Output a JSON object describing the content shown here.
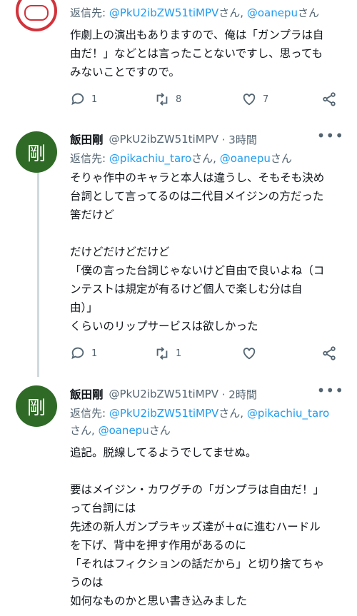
{
  "tweets": [
    {
      "reply_prefix": "返信先: ",
      "mentions": [
        "@PkU2ibZW51tiMPV",
        "@oanepu"
      ],
      "san": "さん",
      "body": "作劇上の演出もありますので、俺は「ガンプラは自\n由だ！」などとは言ったことないですし、思っても\nみないことですので。",
      "counts": {
        "reply": "1",
        "retweet": "8",
        "like": "7"
      }
    },
    {
      "avatar_char": "剛",
      "name": "飯田剛",
      "handle": "@PkU2ibZW51tiMPV",
      "time": "· 3時間",
      "reply_prefix": "返信先: ",
      "mentions": [
        "@pikachiu_taro",
        "@oanepu"
      ],
      "san": "さん",
      "body": "そりゃ作中のキャラと本人は違うし、そもそも決め\n台詞として言ってるのは二代目メイジンの方だった\n筈だけど\n\nだけどだけどだけど\n「僕の言った台詞じゃないけど自由で良いよね（コ\nンテストは規定が有るけど個人で楽しむ分は自\n由）」\nくらいのリップサービスは欲しかった",
      "counts": {
        "reply": "1",
        "retweet": "1",
        "like": ""
      }
    },
    {
      "avatar_char": "剛",
      "name": "飯田剛",
      "handle": "@PkU2ibZW51tiMPV",
      "time": "· 2時間",
      "reply_prefix": "返信先: ",
      "mentions": [
        "@PkU2ibZW51tiMPV",
        "@pikachiu_taro",
        "@oanepu"
      ],
      "san": "さん",
      "body": "追記。脱線してるようでしてませぬ。\n\n要はメイジン・カワグチの「ガンプラは自由だ！」\nって台詞には\n先述の新人ガンプラキッズ達が＋αに進むハードル\nを下げ、背中を押す作用があるのに\n「それはフィクションの話だから」と切り捨てちゃ\nうのは\n如何なものかと思い書き込みました"
    }
  ],
  "colors": {
    "accent": "#1d9bf0",
    "muted": "#536471",
    "avatar_green": "#2f6b26"
  }
}
